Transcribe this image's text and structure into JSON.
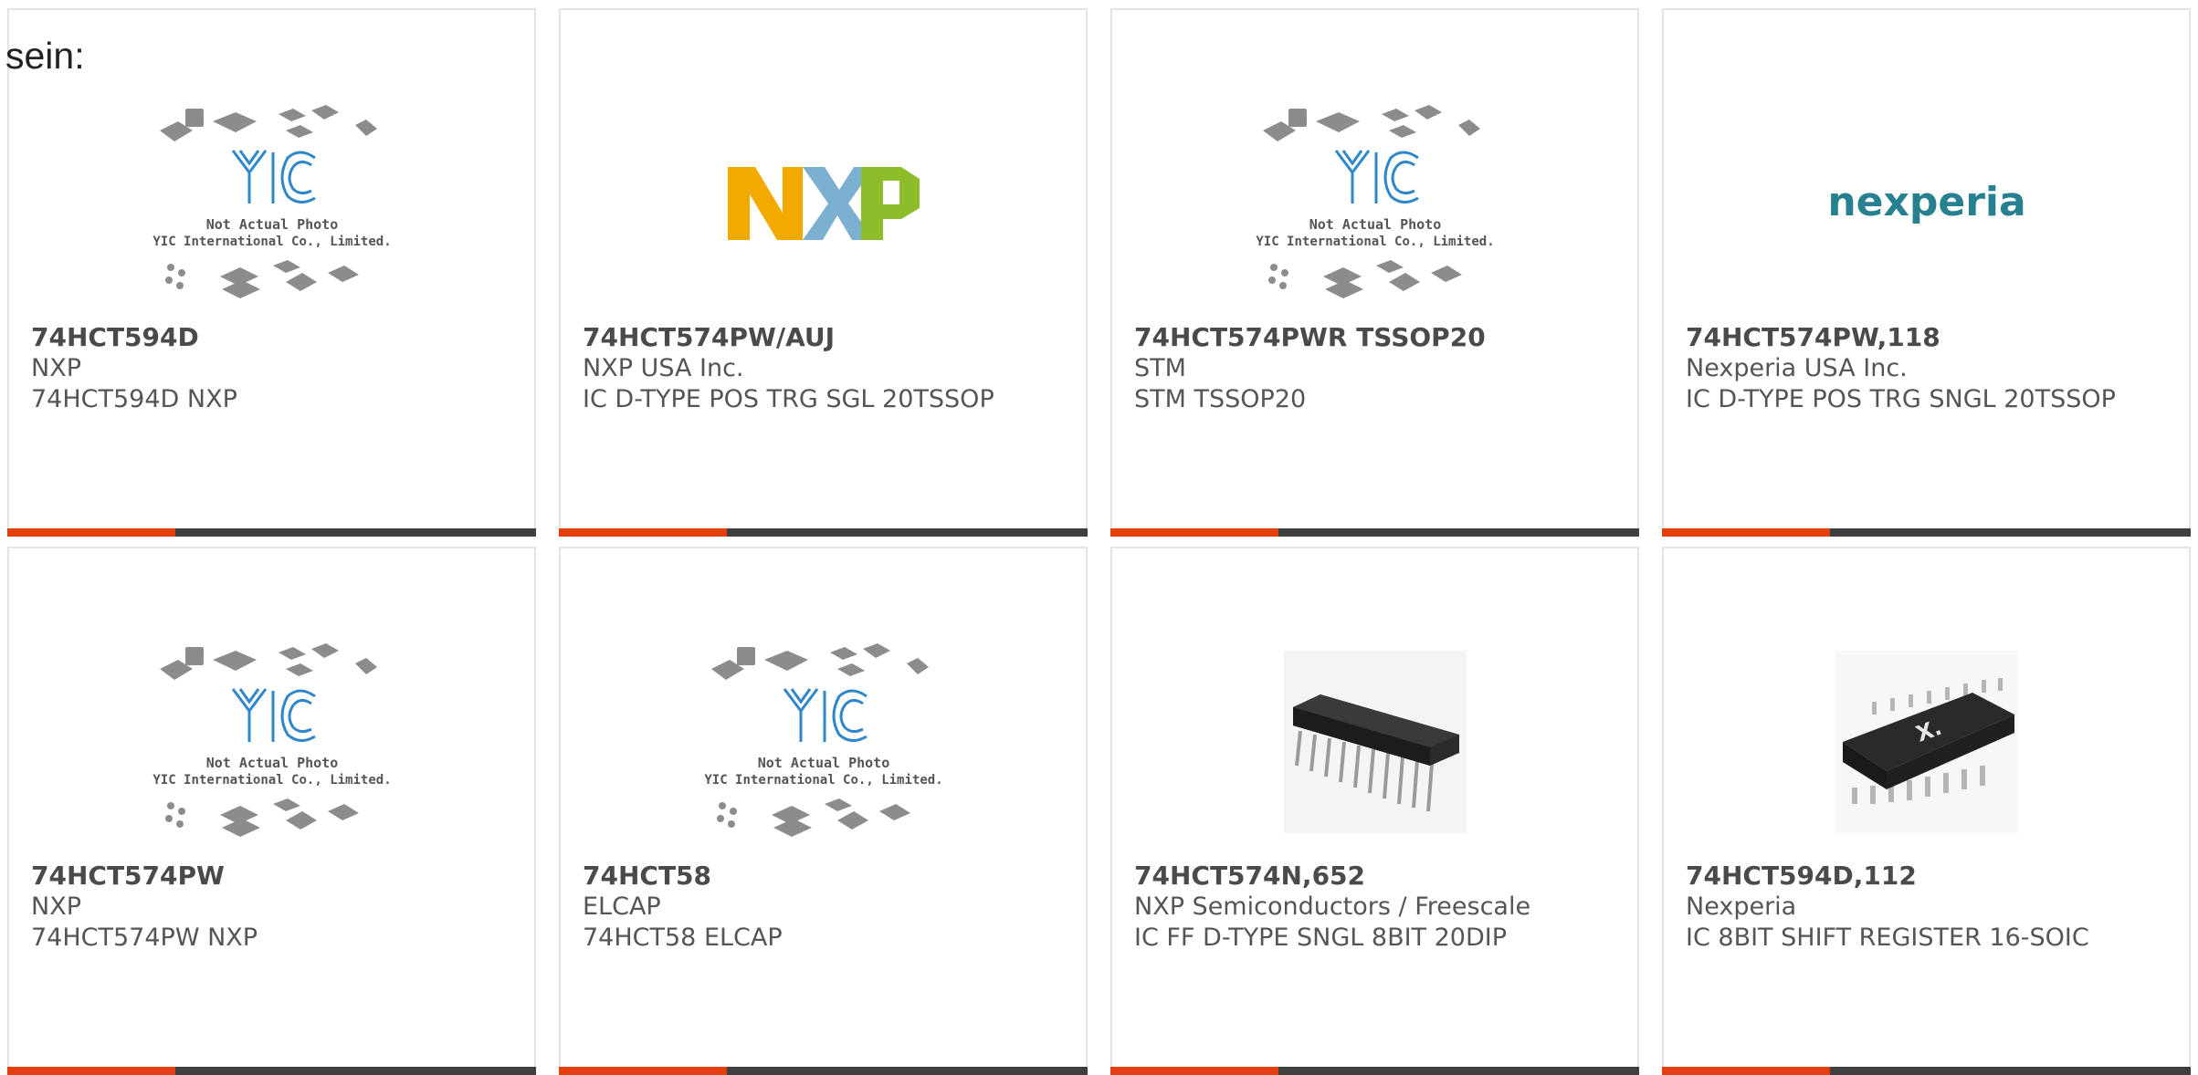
{
  "page": {
    "prefix_text": "sein:"
  },
  "brand_colors": {
    "accent_bar": "#e2400c",
    "bar_dark": "#3f3f3f"
  },
  "yic_caption": {
    "line1": "Not Actual Photo",
    "line2": "YIC International Co., Limited."
  },
  "logos": {
    "nxp": "NXP",
    "nexperia": "nexperia"
  },
  "products": [
    {
      "part": "74HCT594D",
      "manufacturer": "NXP",
      "description": "74HCT594D NXP",
      "image": "yic-placeholder"
    },
    {
      "part": "74HCT574PW/AUJ",
      "manufacturer": "NXP USA Inc.",
      "description": "IC D-TYPE POS TRG SGL 20TSSOP",
      "image": "nxp-logo"
    },
    {
      "part": "74HCT574PWR TSSOP20",
      "manufacturer": "STM",
      "description": "STM TSSOP20",
      "image": "yic-placeholder"
    },
    {
      "part": "74HCT574PW,118",
      "manufacturer": "Nexperia USA Inc.",
      "description": "IC D-TYPE POS TRG SNGL 20TSSOP",
      "image": "nexperia-logo"
    },
    {
      "part": "74HCT574PW",
      "manufacturer": "NXP",
      "description": "74HCT574PW NXP",
      "image": "yic-placeholder"
    },
    {
      "part": "74HCT58",
      "manufacturer": "ELCAP",
      "description": "74HCT58 ELCAP",
      "image": "yic-placeholder"
    },
    {
      "part": "74HCT574N,652",
      "manufacturer": "NXP Semiconductors / Freescale",
      "description": "IC FF D-TYPE SNGL 8BIT 20DIP",
      "image": "dip-chip-photo"
    },
    {
      "part": "74HCT594D,112",
      "manufacturer": "Nexperia",
      "description": "IC 8BIT SHIFT REGISTER 16-SOIC",
      "image": "soic-chip-photo"
    }
  ]
}
